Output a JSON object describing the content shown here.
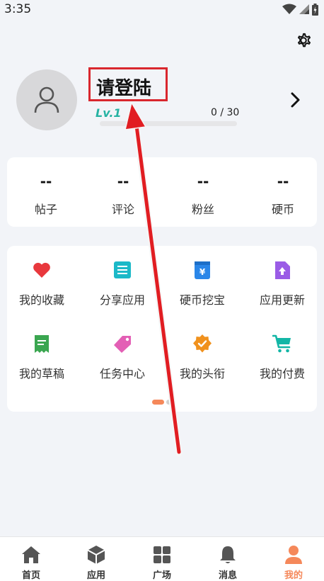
{
  "status_bar": {
    "time": "3:35",
    "icons": [
      "wifi-icon",
      "signal-icon",
      "battery-icon"
    ]
  },
  "header": {
    "settings_icon": "gear-icon"
  },
  "profile": {
    "avatar_icon": "user-icon",
    "login_label": "请登陆",
    "level": "Lv.1",
    "exp_text": "0 / 30",
    "exp_fraction": 0,
    "chevron_icon": "chevron-right-icon"
  },
  "stats": [
    {
      "value": "--",
      "label": "帖子"
    },
    {
      "value": "--",
      "label": "评论"
    },
    {
      "value": "--",
      "label": "粉丝"
    },
    {
      "value": "--",
      "label": "硬币"
    }
  ],
  "features": [
    {
      "label": "我的收藏",
      "icon": "heart-icon",
      "color": "#e8383d"
    },
    {
      "label": "分享应用",
      "icon": "list-icon",
      "color": "#1cb9c8"
    },
    {
      "label": "硬币挖宝",
      "icon": "yen-pouch-icon",
      "color": "#2a86e8"
    },
    {
      "label": "应用更新",
      "icon": "file-upload-icon",
      "color": "#9a5ce6"
    },
    {
      "label": "我的草稿",
      "icon": "receipt-icon",
      "color": "#3aa650"
    },
    {
      "label": "任务中心",
      "icon": "tag-icon",
      "color": "#e35fb5"
    },
    {
      "label": "我的头衔",
      "icon": "badge-check-icon",
      "color": "#f0911d"
    },
    {
      "label": "我的付费",
      "icon": "cart-icon",
      "color": "#13b6a6"
    }
  ],
  "pager": {
    "pages": 2,
    "current": 1
  },
  "nav": [
    {
      "label": "首页",
      "icon": "home-icon",
      "active": false
    },
    {
      "label": "应用",
      "icon": "cube-icon",
      "active": false
    },
    {
      "label": "广场",
      "icon": "grid-icon",
      "active": false
    },
    {
      "label": "消息",
      "icon": "bell-icon",
      "active": false
    },
    {
      "label": "我的",
      "icon": "person-icon",
      "active": true
    }
  ],
  "colors": {
    "accent": "#f5885a",
    "level_teal": "#27b3a3",
    "annotation_red": "#d9272e",
    "background": "#f2f4f8"
  }
}
